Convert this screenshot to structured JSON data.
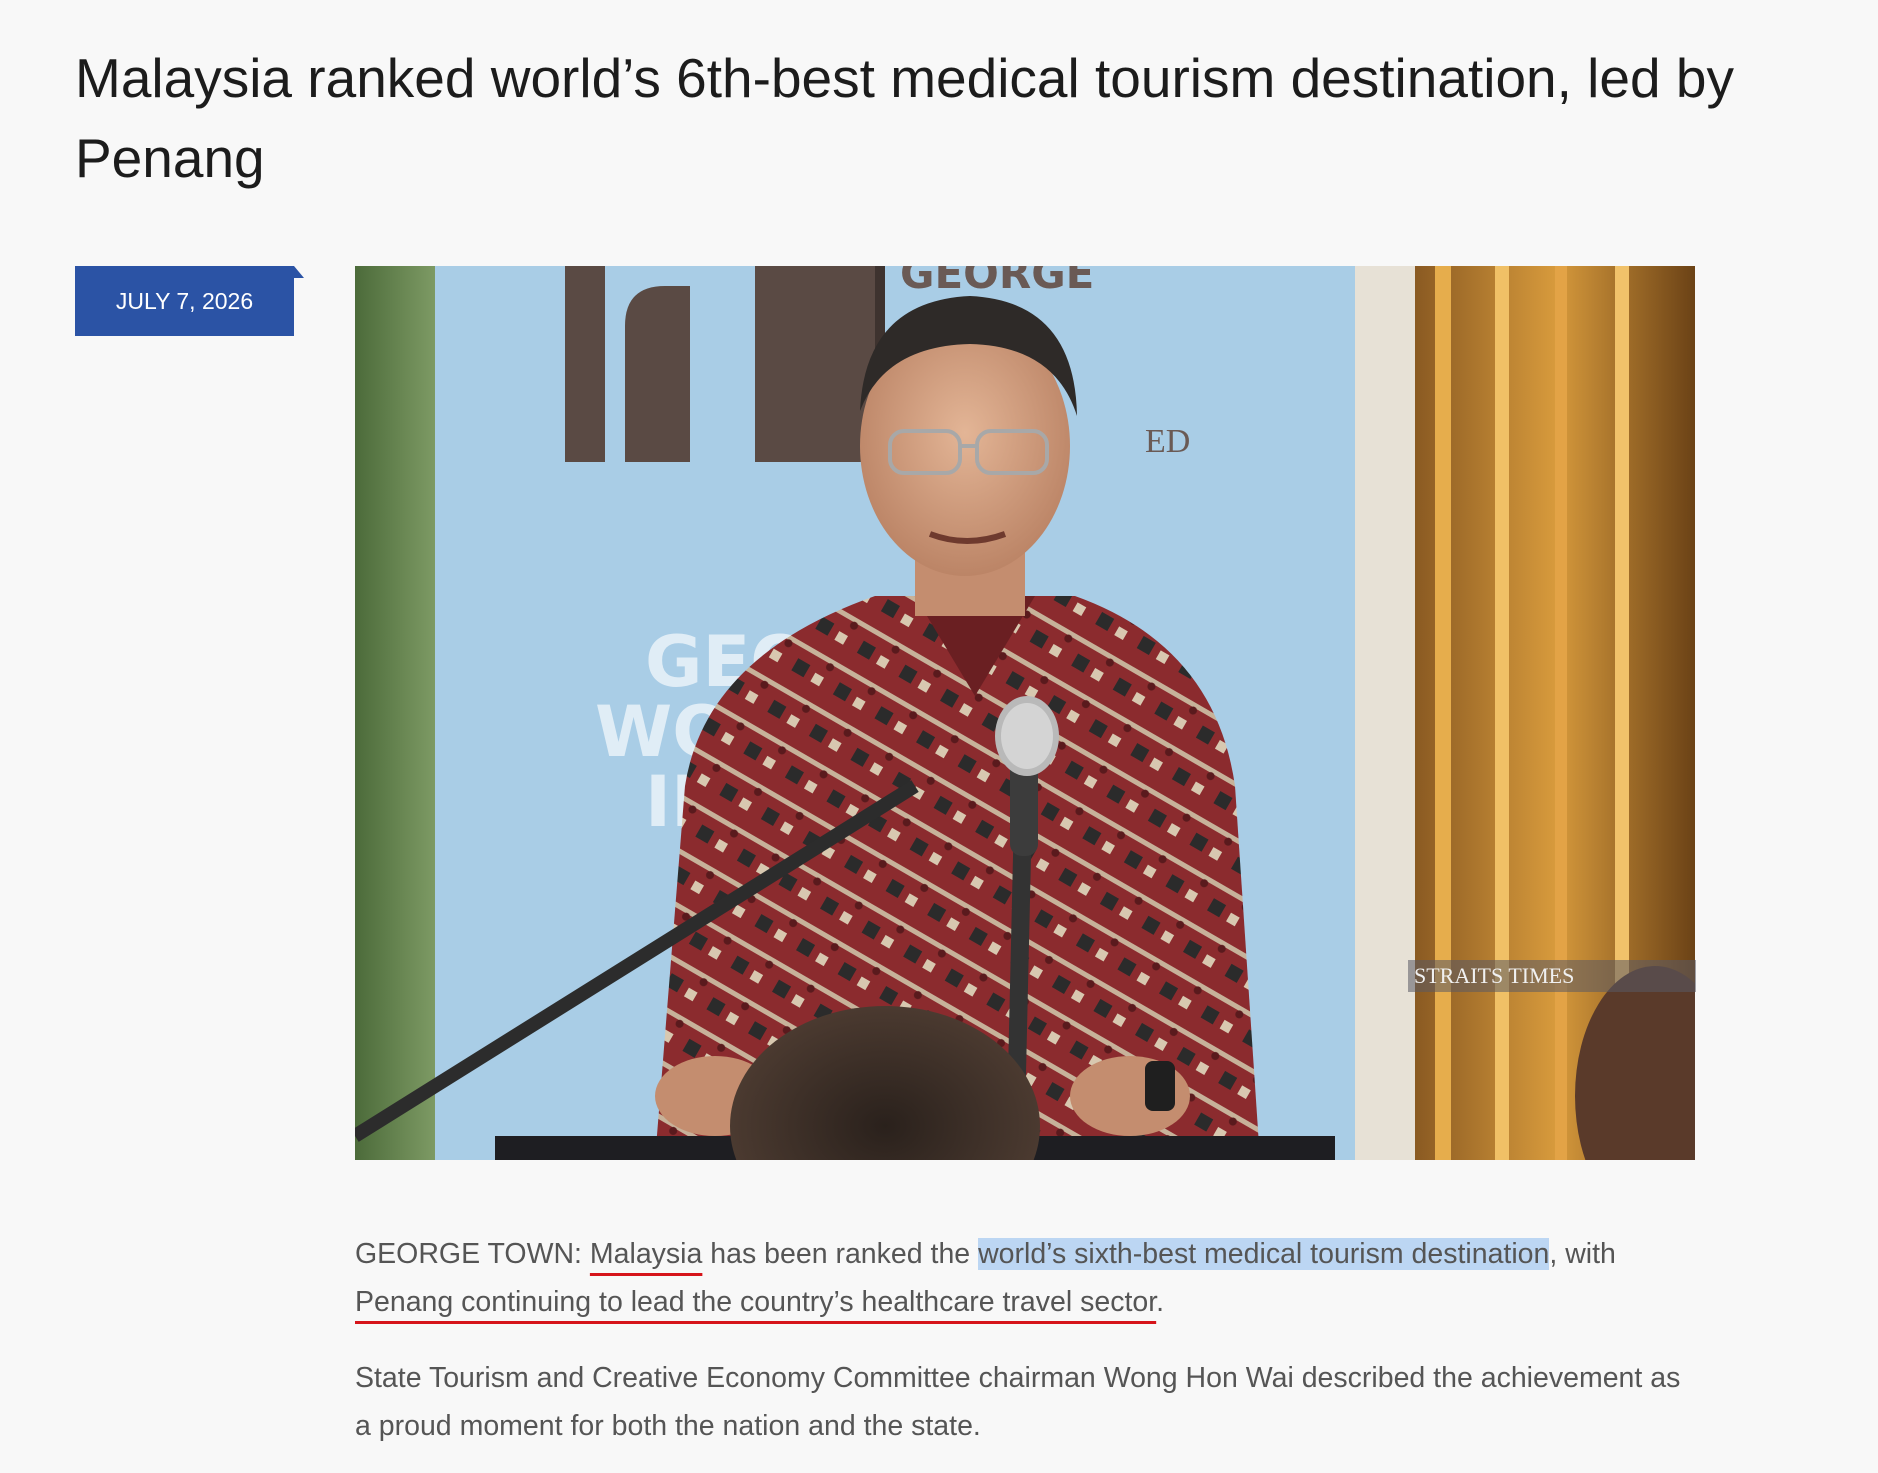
{
  "article": {
    "title": "Malaysia ranked world’s 6th-best medical tourism destination, led by Penang",
    "date": "JULY 7, 2026",
    "image_watermark": "STRAITS TIMES",
    "paragraph1": {
      "lead": "GEORGE TOWN: ",
      "underlined1": "Malaysia",
      "mid": " has been ranked the ",
      "highlighted": "world’s sixth-best medical tourism destination",
      "after_highlight": ", with ",
      "underlined2": "Penang continuing to lead the country’s healthcare travel sector",
      "end": "."
    },
    "paragraph2": "State Tourism and Creative Economy Committee chairman Wong Hon Wai described the achievement as a proud moment for both the nation and the state."
  },
  "colors": {
    "date_badge": "#2b53a5",
    "underline": "#d6141a",
    "highlight": "#bcd6f3"
  }
}
